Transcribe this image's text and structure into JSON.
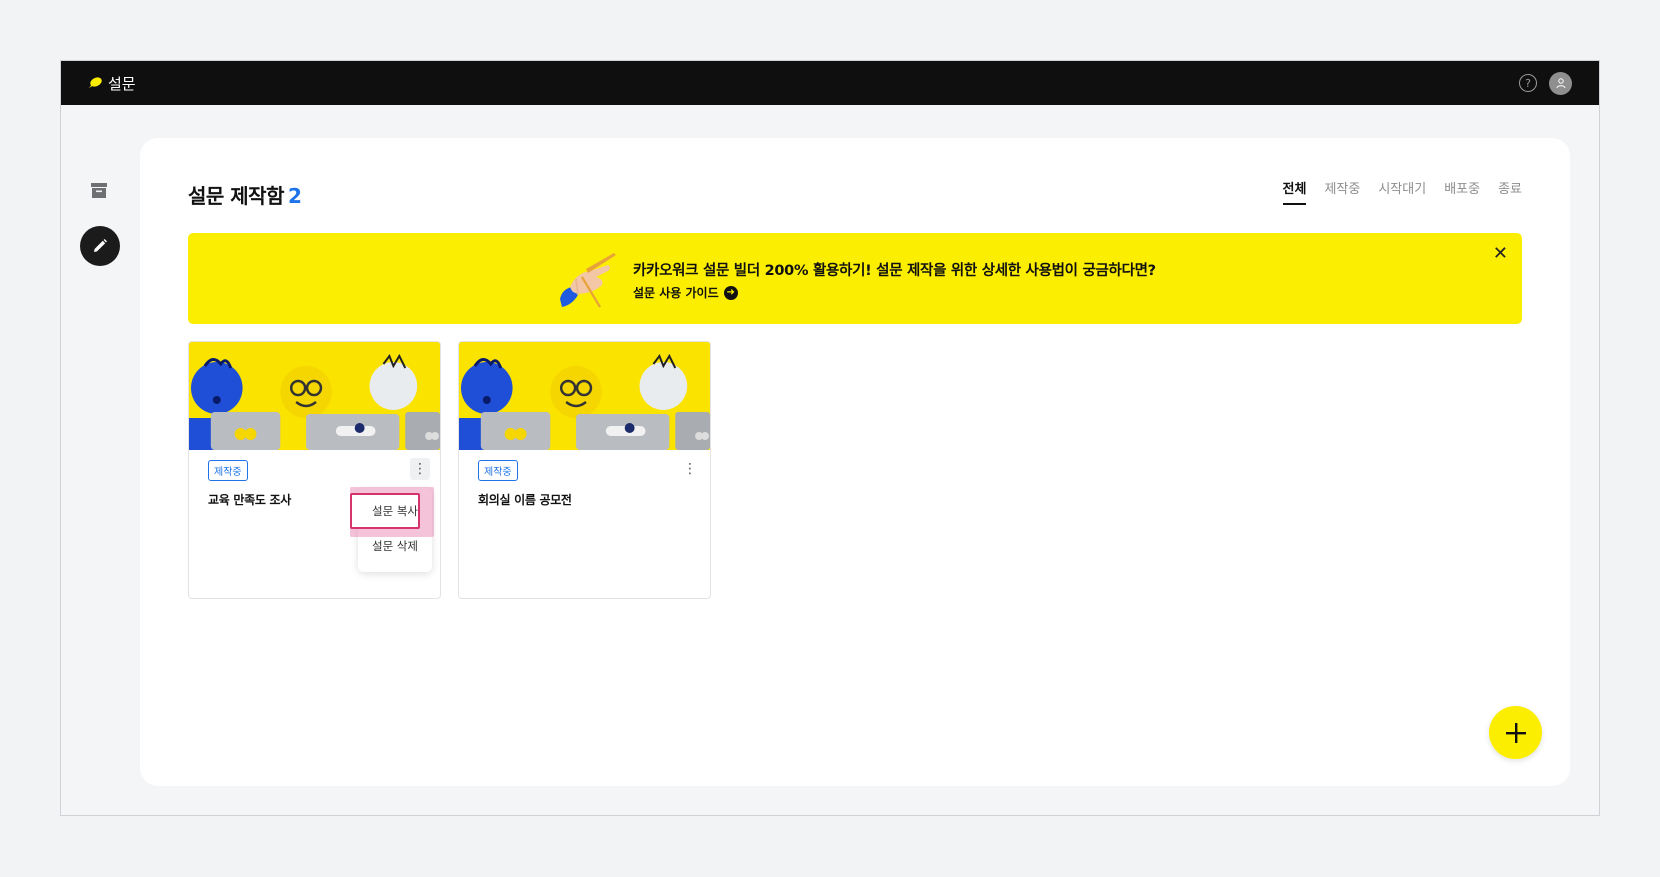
{
  "app": {
    "name": "설문"
  },
  "topbar": {
    "help_icon": "question-circle-icon",
    "avatar_icon": "user-avatar-icon"
  },
  "sidebar": {
    "items": [
      {
        "icon": "archive-box-icon"
      },
      {
        "icon": "pencil-icon"
      }
    ]
  },
  "page": {
    "title": "설문 제작함",
    "count": "2"
  },
  "tabs": [
    {
      "label": "전체",
      "active": true
    },
    {
      "label": "제작중",
      "active": false
    },
    {
      "label": "시작대기",
      "active": false
    },
    {
      "label": "배포중",
      "active": false
    },
    {
      "label": "종료",
      "active": false
    }
  ],
  "banner": {
    "message": "카카오워크 설문 빌더 200% 활용하기! 설문 제작을 위한 상세한 사용법이 궁금하다면?",
    "link_label": "설문 사용 가이드",
    "link_icon": "arrow-right-circle-icon",
    "close_icon": "close-icon",
    "background": "#fcee00"
  },
  "cards": [
    {
      "status": "제작중",
      "title": "교육 만족도 조사"
    },
    {
      "status": "제작중",
      "title": "회의실 이름 공모전"
    }
  ],
  "context_menu": {
    "items": [
      "설문 복사",
      "설문 삭제"
    ],
    "highlighted": "설문 복사"
  },
  "fab": {
    "icon": "plus-icon"
  },
  "colors": {
    "accent_blue": "#1e73e8",
    "brand_yellow": "#fcee00",
    "topbar": "#0f0f0f"
  }
}
